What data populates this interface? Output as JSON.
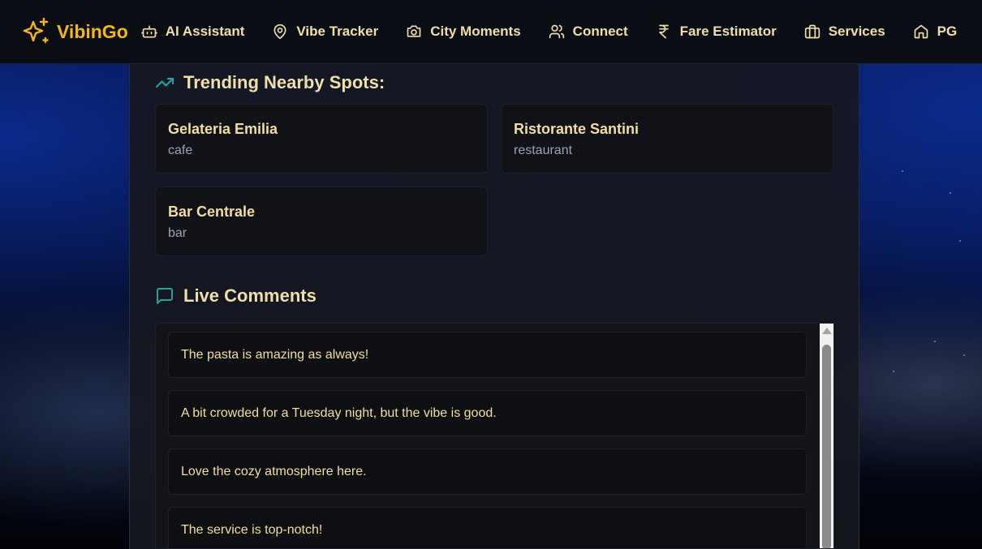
{
  "brand": {
    "name": "VibinGo",
    "icon": "sparkles-icon",
    "color": "#f5b718"
  },
  "nav": {
    "items": [
      {
        "label": "AI Assistant",
        "icon": "bot-icon"
      },
      {
        "label": "Vibe Tracker",
        "icon": "map-pin-icon"
      },
      {
        "label": "City Moments",
        "icon": "camera-icon"
      },
      {
        "label": "Connect",
        "icon": "users-icon"
      },
      {
        "label": "Fare Estimator",
        "icon": "rupee-icon"
      },
      {
        "label": "Services",
        "icon": "briefcase-icon"
      },
      {
        "label": "PG",
        "icon": "home-icon"
      }
    ]
  },
  "trending": {
    "title": "Trending Nearby Spots:",
    "icon": "trending-up-icon",
    "spots": [
      {
        "name": "Gelateria Emilia",
        "type": "cafe"
      },
      {
        "name": "Ristorante Santini",
        "type": "restaurant"
      },
      {
        "name": "Bar Centrale",
        "type": "bar"
      }
    ]
  },
  "comments": {
    "title": "Live Comments",
    "icon": "message-square-icon",
    "items": [
      "The pasta is amazing as always!",
      "A bit crowded for a Tuesday night, but the vibe is good.",
      "Love the cozy atmosphere here.",
      "The service is top-notch!"
    ]
  },
  "colors": {
    "accent_text": "#f0dfa8",
    "icon_teal": "#1fa39a",
    "brand": "#f5b718"
  }
}
